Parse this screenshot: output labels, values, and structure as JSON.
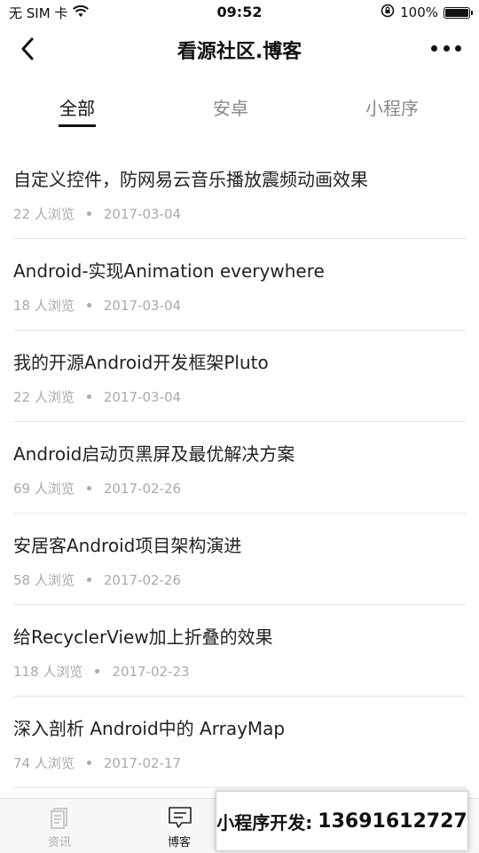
{
  "status_bar": {
    "carrier": "无 SIM 卡",
    "time": "09:52",
    "battery_percent": "100%",
    "battery_level": 1.0
  },
  "nav": {
    "title": "看源社区.博客"
  },
  "tabs": [
    {
      "label": "全部",
      "active": true
    },
    {
      "label": "安卓",
      "active": false
    },
    {
      "label": "小程序",
      "active": false
    }
  ],
  "articles": [
    {
      "title": "自定义控件，防网易云音乐播放震频动画效果",
      "views": "22 人浏览",
      "date": "2017-03-04"
    },
    {
      "title": "Android-实现Animation everywhere",
      "views": "18 人浏览",
      "date": "2017-03-04"
    },
    {
      "title": "我的开源Android开发框架Pluto",
      "views": "22 人浏览",
      "date": "2017-03-04"
    },
    {
      "title": "Android启动页黑屏及最优解决方案",
      "views": "69 人浏览",
      "date": "2017-02-26"
    },
    {
      "title": "安居客Android项目架构演进",
      "views": "58 人浏览",
      "date": "2017-02-26"
    },
    {
      "title": "给RecyclerView加上折叠的效果",
      "views": "118 人浏览",
      "date": "2017-02-23"
    },
    {
      "title": "深入剖析 Android中的 ArrayMap",
      "views": "74 人浏览",
      "date": "2017-02-17"
    }
  ],
  "tabbar": [
    {
      "label": "资讯",
      "icon": "document-icon",
      "active": false
    },
    {
      "label": "博客",
      "icon": "message-icon",
      "active": true
    }
  ],
  "promo": {
    "label": "小程序开发:",
    "phone": "13691612727"
  },
  "colors": {
    "text_primary": "#222222",
    "text_secondary": "#aaaaaa",
    "divider": "#e5e5e5",
    "tabbar_bg": "#f8f8f8"
  }
}
